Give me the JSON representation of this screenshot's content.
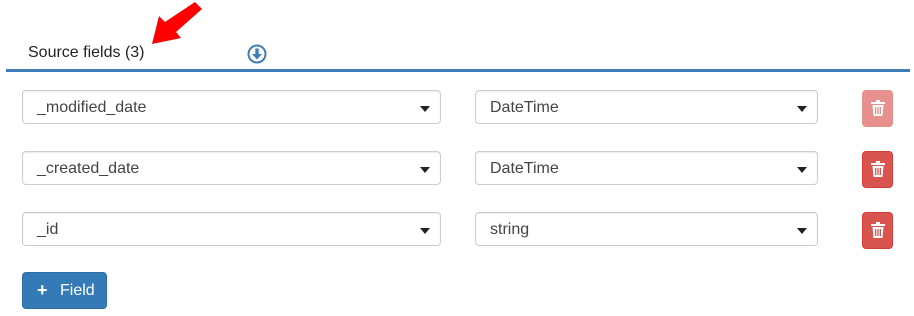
{
  "header": {
    "title": "Source fields (3)"
  },
  "icons": {
    "arrow": "red-arrow-annotation",
    "download": "circle-arrow-down-icon",
    "delete": "trash-icon",
    "add": "plus-icon"
  },
  "colors": {
    "accent": "#3f7cb8",
    "primary_button": "#337ab7",
    "danger_button": "#d9534f",
    "danger_button_disabled": "#e8908d",
    "annotation_arrow": "#ff0000"
  },
  "fields": [
    {
      "name": "_modified_date",
      "type": "DateTime",
      "delete_disabled": true
    },
    {
      "name": "_created_date",
      "type": "DateTime",
      "delete_disabled": false
    },
    {
      "name": "_id",
      "type": "string",
      "delete_disabled": false
    }
  ],
  "add_button": {
    "label": "Field"
  }
}
